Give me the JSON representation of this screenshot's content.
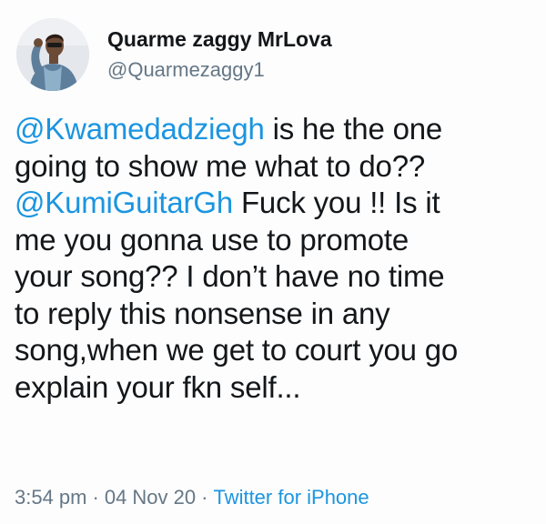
{
  "tweet": {
    "author": {
      "display_name": "Quarme zaggy MrLova",
      "handle": "@Quarmezaggy1",
      "avatar_icon": "profile-photo"
    },
    "text_lines": [
      {
        "mention": "@Kwamedadziegh",
        "text": " is he the one"
      },
      {
        "mention": "",
        "text": "going to show me what to do??"
      },
      {
        "mention": "@KumiGuitarGh",
        "text": " Fuck you !! Is it"
      },
      {
        "mention": "",
        "text": "me you gonna use to promote"
      },
      {
        "mention": "",
        "text": "your song?? I don’t have no time"
      },
      {
        "mention": "",
        "text": "to reply this nonsense in any"
      },
      {
        "mention": "",
        "text": "song,when we get to court you go"
      },
      {
        "mention": "",
        "text": "explain your fkn self..."
      }
    ],
    "meta": {
      "time": "3:54 pm",
      "separator": "·",
      "date": "04 Nov 20",
      "source": "Twitter for iPhone"
    },
    "colors": {
      "link": "#1b95e0",
      "secondary_text": "#657786",
      "primary_text": "#14171a"
    }
  }
}
